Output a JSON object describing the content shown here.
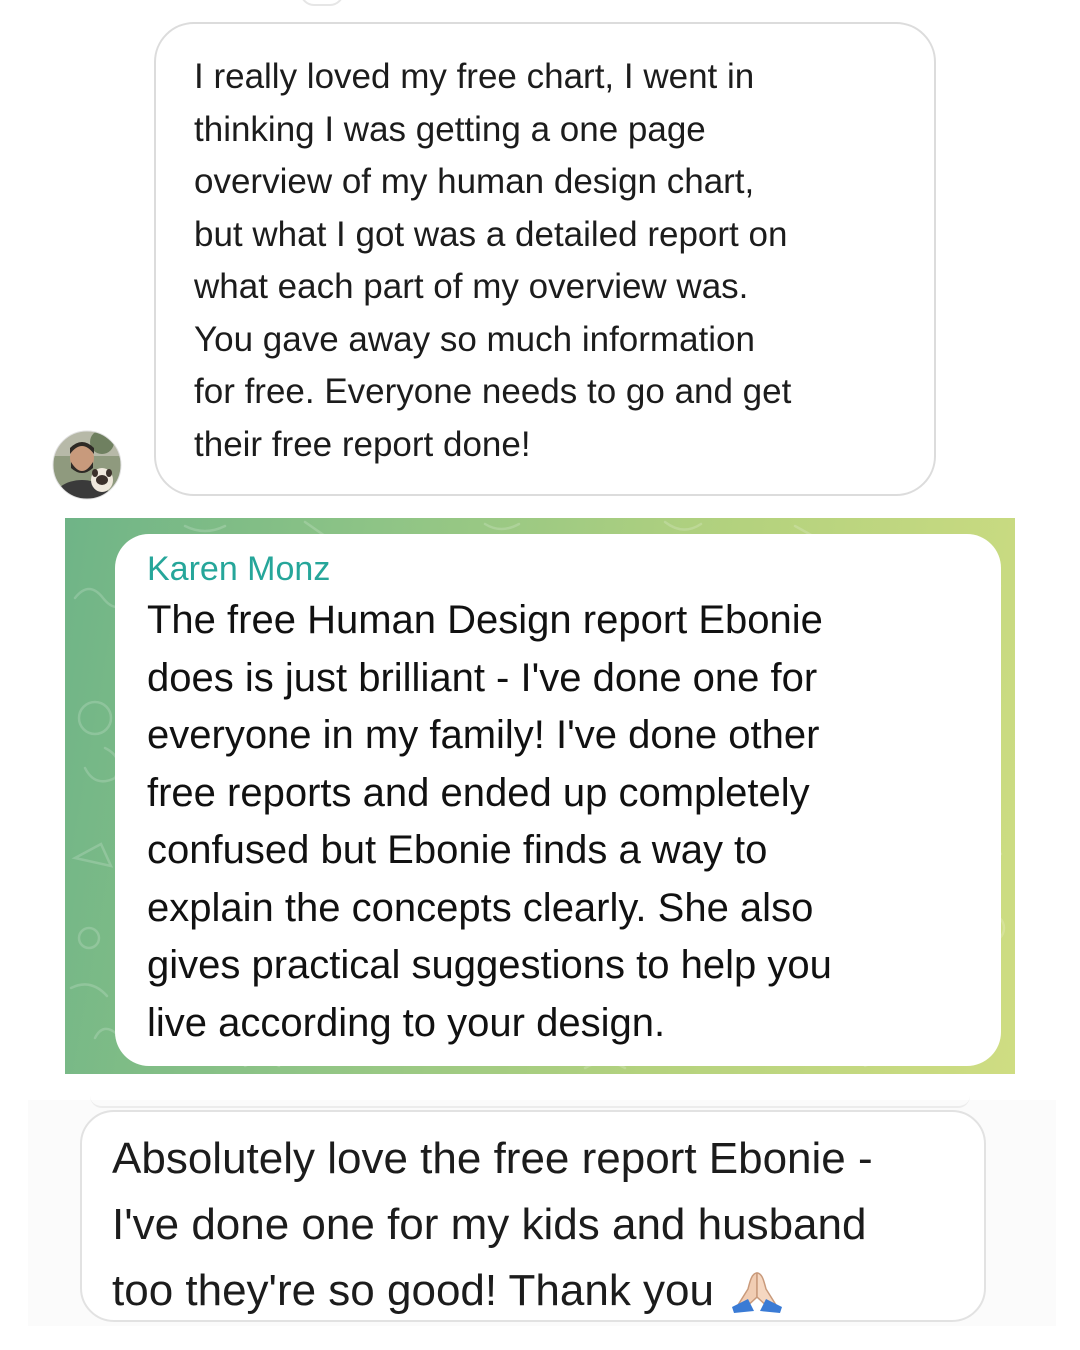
{
  "messages": {
    "first": {
      "text": "I really loved my free chart, I went in\nthinking I was getting a one page\noverview of my human design chart,\nbut what I got was a detailed report on\nwhat each part of my overview was.\nYou gave away so much information\nfor free. Everyone needs to go and get\ntheir free report done!"
    },
    "second": {
      "sender": "Karen Monz",
      "text": "The free Human Design report Ebonie\ndoes is just brilliant - I've done one for\neveryone in my family!  I've done other\nfree reports and ended up completely\nconfused but Ebonie finds a way to\nexplain the concepts clearly. She also\ngives practical suggestions to help you\nlive according to your design."
    },
    "third": {
      "text": "Absolutely love the free report Ebonie -\nI've done one for my kids and husband\ntoo they're so good!  Thank you",
      "emoji": "folded-hands-icon"
    }
  },
  "colors": {
    "sender_name": "#26a69a",
    "telegram_bg_start": "#6fb487",
    "telegram_bg_end": "#cfdd82",
    "bubble_border": "#dcdcdc"
  }
}
